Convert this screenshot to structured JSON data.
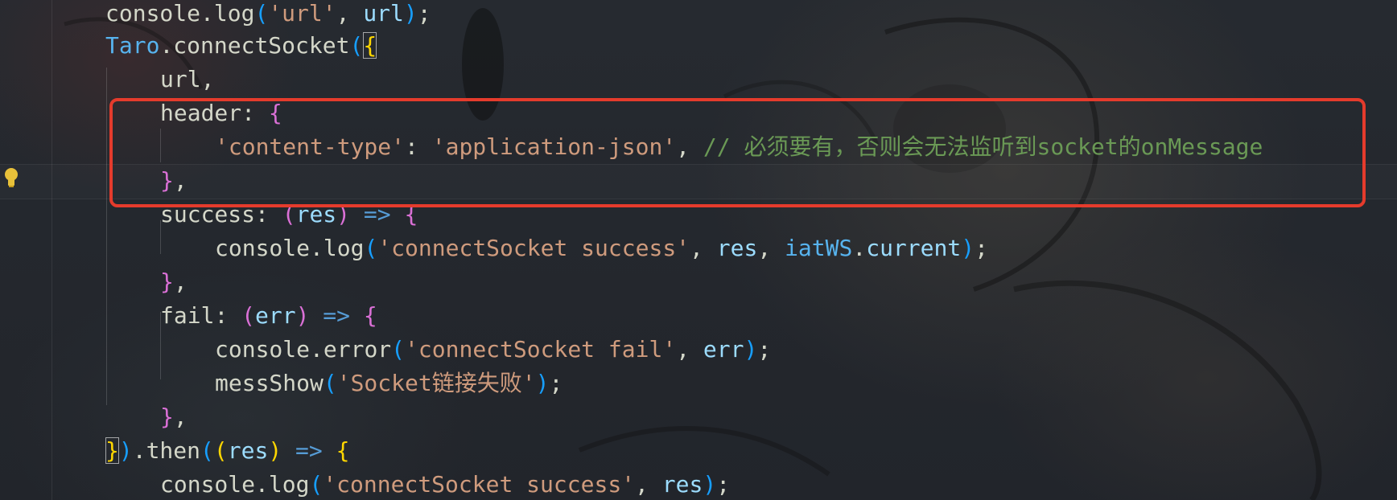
{
  "editor": {
    "highlight_color": "#e53b2c",
    "lines": [
      [
        {
          "t": "console",
          "c": "plain"
        },
        {
          "t": ".",
          "c": "plain"
        },
        {
          "t": "log",
          "c": "plain"
        },
        {
          "t": "(",
          "c": "b3"
        },
        {
          "t": "'url'",
          "c": "str"
        },
        {
          "t": ", ",
          "c": "plain"
        },
        {
          "t": "url",
          "c": "var"
        },
        {
          "t": ")",
          "c": "b3"
        },
        {
          "t": ";",
          "c": "plain"
        }
      ],
      [
        {
          "t": "Taro",
          "c": "cls"
        },
        {
          "t": ".",
          "c": "plain"
        },
        {
          "t": "connectSocket",
          "c": "plain"
        },
        {
          "t": "(",
          "c": "b3"
        },
        {
          "t": "{",
          "c": "b1"
        }
      ],
      [
        {
          "t": "url",
          "c": "plain"
        },
        {
          "t": ",",
          "c": "plain"
        }
      ],
      [
        {
          "t": "header",
          "c": "plain"
        },
        {
          "t": ": ",
          "c": "plain"
        },
        {
          "t": "{",
          "c": "b2"
        }
      ],
      [
        {
          "t": "'content-type'",
          "c": "str"
        },
        {
          "t": ": ",
          "c": "plain"
        },
        {
          "t": "'application-json'",
          "c": "str"
        },
        {
          "t": ", ",
          "c": "plain"
        },
        {
          "t": "// 必须要有，否则会无法监听到socket的onMessage",
          "c": "cmt"
        }
      ],
      [
        {
          "t": "}",
          "c": "b2"
        },
        {
          "t": ",",
          "c": "plain"
        }
      ],
      [
        {
          "t": "success",
          "c": "plain"
        },
        {
          "t": ": ",
          "c": "plain"
        },
        {
          "t": "(",
          "c": "b2"
        },
        {
          "t": "res",
          "c": "var"
        },
        {
          "t": ")",
          "c": "b2"
        },
        {
          "t": " => ",
          "c": "op"
        },
        {
          "t": "{",
          "c": "b2"
        }
      ],
      [
        {
          "t": "console",
          "c": "plain"
        },
        {
          "t": ".",
          "c": "plain"
        },
        {
          "t": "log",
          "c": "plain"
        },
        {
          "t": "(",
          "c": "b3"
        },
        {
          "t": "'connectSocket success'",
          "c": "str"
        },
        {
          "t": ", ",
          "c": "plain"
        },
        {
          "t": "res",
          "c": "var"
        },
        {
          "t": ", ",
          "c": "plain"
        },
        {
          "t": "iatWS",
          "c": "cls"
        },
        {
          "t": ".",
          "c": "plain"
        },
        {
          "t": "current",
          "c": "var"
        },
        {
          "t": ")",
          "c": "b3"
        },
        {
          "t": ";",
          "c": "plain"
        }
      ],
      [
        {
          "t": "}",
          "c": "b2"
        },
        {
          "t": ",",
          "c": "plain"
        }
      ],
      [
        {
          "t": "fail",
          "c": "plain"
        },
        {
          "t": ": ",
          "c": "plain"
        },
        {
          "t": "(",
          "c": "b2"
        },
        {
          "t": "err",
          "c": "var"
        },
        {
          "t": ")",
          "c": "b2"
        },
        {
          "t": " => ",
          "c": "op"
        },
        {
          "t": "{",
          "c": "b2"
        }
      ],
      [
        {
          "t": "console",
          "c": "plain"
        },
        {
          "t": ".",
          "c": "plain"
        },
        {
          "t": "error",
          "c": "plain"
        },
        {
          "t": "(",
          "c": "b3"
        },
        {
          "t": "'connectSocket fail'",
          "c": "str"
        },
        {
          "t": ", ",
          "c": "plain"
        },
        {
          "t": "err",
          "c": "var"
        },
        {
          "t": ")",
          "c": "b3"
        },
        {
          "t": ";",
          "c": "plain"
        }
      ],
      [
        {
          "t": "messShow",
          "c": "plain"
        },
        {
          "t": "(",
          "c": "b3"
        },
        {
          "t": "'Socket链接失败'",
          "c": "str"
        },
        {
          "t": ")",
          "c": "b3"
        },
        {
          "t": ";",
          "c": "plain"
        }
      ],
      [
        {
          "t": "}",
          "c": "b2"
        },
        {
          "t": ",",
          "c": "plain"
        }
      ],
      [
        {
          "t": "}",
          "c": "b1"
        },
        {
          "t": ")",
          "c": "b3"
        },
        {
          "t": ".",
          "c": "plain"
        },
        {
          "t": "then",
          "c": "plain"
        },
        {
          "t": "(",
          "c": "b3"
        },
        {
          "t": "(",
          "c": "b1"
        },
        {
          "t": "res",
          "c": "var"
        },
        {
          "t": ")",
          "c": "b1"
        },
        {
          "t": " => ",
          "c": "op"
        },
        {
          "t": "{",
          "c": "b1"
        }
      ],
      [
        {
          "t": "console",
          "c": "plain"
        },
        {
          "t": ".",
          "c": "plain"
        },
        {
          "t": "log",
          "c": "plain"
        },
        {
          "t": "(",
          "c": "b3"
        },
        {
          "t": "'connectSocket success'",
          "c": "str"
        },
        {
          "t": ", ",
          "c": "plain"
        },
        {
          "t": "res",
          "c": "var"
        },
        {
          "t": ")",
          "c": "b3"
        },
        {
          "t": ";",
          "c": "plain"
        }
      ]
    ]
  }
}
